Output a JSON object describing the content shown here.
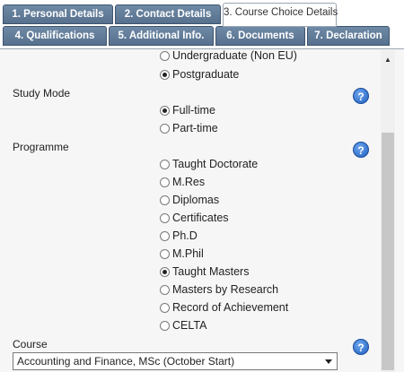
{
  "tabs_row1": [
    {
      "label": "1. Personal Details",
      "active": false
    },
    {
      "label": "2. Contact Details",
      "active": false
    },
    {
      "label": "3. Course Choice Details",
      "active": true
    }
  ],
  "tabs_row2": [
    {
      "label": "4. Qualifications"
    },
    {
      "label": "5. Additional Info."
    },
    {
      "label": "6. Documents"
    },
    {
      "label": "7. Declaration"
    }
  ],
  "level": {
    "options": [
      "Undergraduate (Non EU)",
      "Postgraduate"
    ],
    "selected": "Postgraduate"
  },
  "study_mode": {
    "label": "Study Mode",
    "options": [
      "Full-time",
      "Part-time"
    ],
    "selected": "Full-time"
  },
  "programme": {
    "label": "Programme",
    "options": [
      "Taught Doctorate",
      "M.Res",
      "Diplomas",
      "Certificates",
      "Ph.D",
      "M.Phil",
      "Taught Masters",
      "Masters by Research",
      "Record of Achievement",
      "CELTA"
    ],
    "selected": "Taught Masters"
  },
  "course": {
    "label": "Course",
    "value": "Accounting and Finance, MSc (October Start)"
  },
  "help_glyph": "?",
  "icons": {
    "help": "question-circle-icon",
    "dropdown": "caret-down-icon",
    "scroll_up": "arrow-up-icon"
  }
}
